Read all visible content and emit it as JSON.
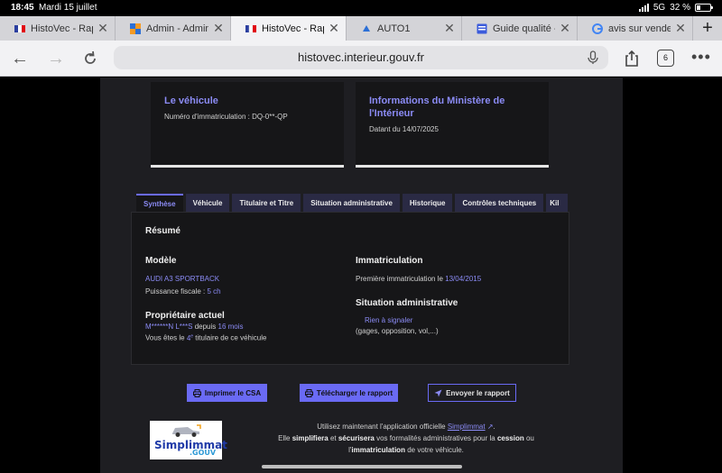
{
  "status_bar": {
    "time": "18:45",
    "date": "Mardi 15 juillet",
    "network": "5G",
    "battery": "32 %",
    "battery_level": 0.32
  },
  "browser_tabs": [
    {
      "title": "HistoVec - Rapport",
      "favicon": "french-flag-icon",
      "active": false
    },
    {
      "title": "Admin - Admin Cli",
      "favicon": "admin-icon",
      "active": false
    },
    {
      "title": "HistoVec - Rapport",
      "favicon": "french-flag-icon",
      "active": true
    },
    {
      "title": "AUTO1",
      "favicon": "auto1-icon",
      "active": false
    },
    {
      "title": "Guide qualité - Co",
      "favicon": "guide-icon",
      "active": false
    },
    {
      "title": "avis sur vendezvot",
      "favicon": "google-icon",
      "active": false
    }
  ],
  "toolbar": {
    "url": "histovec.interieur.gouv.fr",
    "tab_count": "6"
  },
  "cards": {
    "vehicle": {
      "title": "Le véhicule",
      "text": "Numéro d'immatriculation : DQ-0**-QP"
    },
    "ministry": {
      "title": "Informations du Ministère de l'Intérieur",
      "text": "Datant du 14/07/2025"
    }
  },
  "page_tabs": [
    "Synthèse",
    "Véhicule",
    "Titulaire et Titre",
    "Situation administrative",
    "Historique",
    "Contrôles techniques",
    "Kil"
  ],
  "summary": {
    "heading": "Résumé",
    "model": {
      "heading": "Modèle",
      "name": "AUDI A3 SPORTBACK",
      "fiscal_label": "Puissance fiscale :",
      "fiscal_value": "5 ch"
    },
    "registration": {
      "heading": "Immatriculation",
      "first_label": "Première immatriculation le",
      "first_date": "13/04/2015"
    },
    "owner": {
      "heading": "Propriétaire actuel",
      "name": "M******N L***S",
      "since_label": "depuis",
      "since_value": "16 mois",
      "rank_prefix": "Vous êtes le",
      "rank_number": "4",
      "rank_suffix": "e",
      "rank_rest": "titulaire de ce véhicule"
    },
    "admin": {
      "heading": "Situation administrative",
      "status": "Rien à signaler",
      "detail": "(gages, opposition, vol,...)"
    }
  },
  "actions": {
    "print": "Imprimer le CSA",
    "download": "Télécharger le rapport",
    "send": "Envoyer le rapport"
  },
  "promo": {
    "logo_main": "Simplimmat",
    "logo_sub": ".GOUV",
    "line1_prefix": "Utilisez maintenant l'application officielle",
    "line1_link": "Simplimmat",
    "line1_suffix": ".",
    "line2_a": "Elle",
    "line2_b": "simplifiera",
    "line2_c": "et",
    "line2_d": "sécurisera",
    "line2_e": "vos formalités administratives pour la",
    "line2_f": "cession",
    "line2_g": "ou",
    "line3_a": "l'",
    "line3_b": "immatriculation",
    "line3_c": "de votre véhicule."
  },
  "colors": {
    "accent": "#6a6af4",
    "link": "#8b8bf5",
    "page_bg": "#1e1e22",
    "card_bg": "#161618"
  }
}
